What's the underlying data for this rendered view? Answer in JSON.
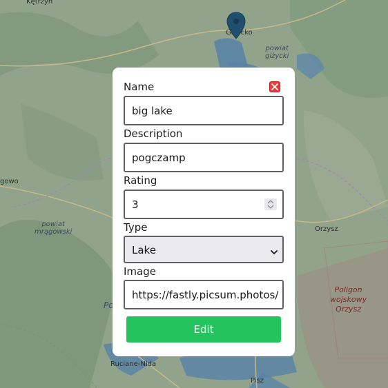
{
  "map": {
    "places": {
      "ketrzyn": "Kętrzyn",
      "gizycko": "Giżycko",
      "mragowo": "gowo",
      "orzysz": "Orzysz",
      "ruciane": "Ruciane-Nida",
      "pisz": "Pisz",
      "po": "Po"
    },
    "regions": {
      "powiat_gizycki": "powiat\ngiżycki",
      "powiat_mragowski": "powiat\nmrągowski",
      "poligon": "Poligon\nwojskowy\nOrzysz"
    },
    "marker_icon": "map-pin-icon"
  },
  "form": {
    "name_label": "Name",
    "name_value": "big lake",
    "description_label": "Description",
    "description_value": "pogczamp",
    "rating_label": "Rating",
    "rating_value": "3",
    "type_label": "Type",
    "type_value": "Lake",
    "image_label": "Image",
    "image_value": "https://fastly.picsum.photos/id",
    "submit_label": "Edit",
    "close_icon": "close-icon"
  },
  "colors": {
    "accent": "#23c45e",
    "close": "#ee3b3b",
    "marker": "#1f4e6e"
  }
}
